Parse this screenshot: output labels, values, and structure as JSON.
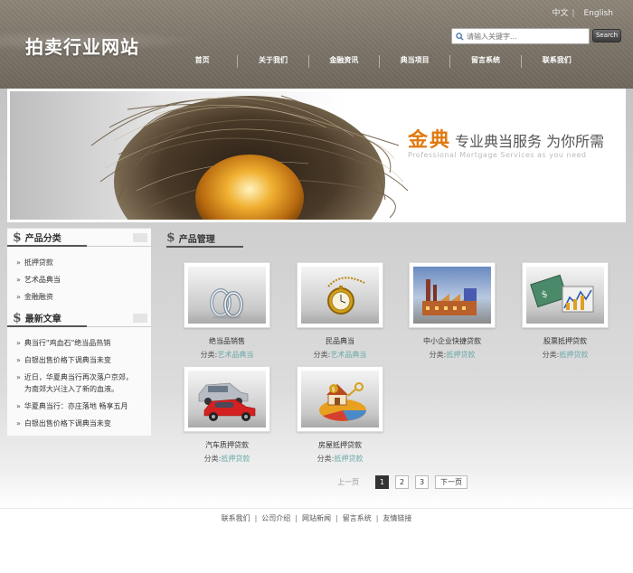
{
  "header": {
    "logo": "拍卖行业网站",
    "lang": {
      "zh": "中文",
      "sep": "|",
      "en": "English"
    },
    "search": {
      "placeholder": "请输入关键字...",
      "button": "Search"
    },
    "nav": [
      "首页",
      "关于我们",
      "金融资讯",
      "典当项目",
      "留言系统",
      "联系我们"
    ]
  },
  "banner": {
    "title_gold": "金典",
    "title_rest": "专业典当服务  为你所需",
    "subtitle": "Professional Mortgage Services as you need"
  },
  "sidebar": {
    "categories": {
      "title": "产品分类",
      "items": [
        "抵押贷款",
        "艺术品典当",
        "金融融资"
      ]
    },
    "articles": {
      "title": "最新文章",
      "items": [
        {
          "l1": "典当行\"鸡血石\"绝当品热销"
        },
        {
          "l1": "白银出售价格下调典当未变"
        },
        {
          "l1": "近日，华夏典当行再次落户京郊，",
          "l2": "为南郊大兴注入了新的血液。"
        },
        {
          "l1": "华夏典当行：亦庄落地 畅享五月"
        },
        {
          "l1": "白银出售价格下调典当未变"
        }
      ]
    }
  },
  "main": {
    "title": "产品管理",
    "cat_prefix": "分类:",
    "products": [
      {
        "name": "绝当品销售",
        "category": "艺术品典当",
        "icon": "rings-icon"
      },
      {
        "name": "民品典当",
        "category": "艺术品典当",
        "icon": "pocket-watch-icon"
      },
      {
        "name": "中小企业快捷贷款",
        "category": "抵押贷款",
        "icon": "factory-icon"
      },
      {
        "name": "股票抵押贷款",
        "category": "抵押贷款",
        "icon": "stock-chart-icon"
      },
      {
        "name": "汽车质押贷款",
        "category": "抵押贷款",
        "icon": "cars-icon"
      },
      {
        "name": "房屋抵押贷款",
        "category": "抵押贷款",
        "icon": "house-key-icon"
      }
    ],
    "pager": {
      "prev": "上一页",
      "pages": [
        "1",
        "2",
        "3"
      ],
      "next": "下一页"
    }
  },
  "footer": {
    "links": [
      "联系我们",
      "公司介绍",
      "网站新闻",
      "留言系统",
      "友情链接"
    ],
    "sep": "|"
  }
}
